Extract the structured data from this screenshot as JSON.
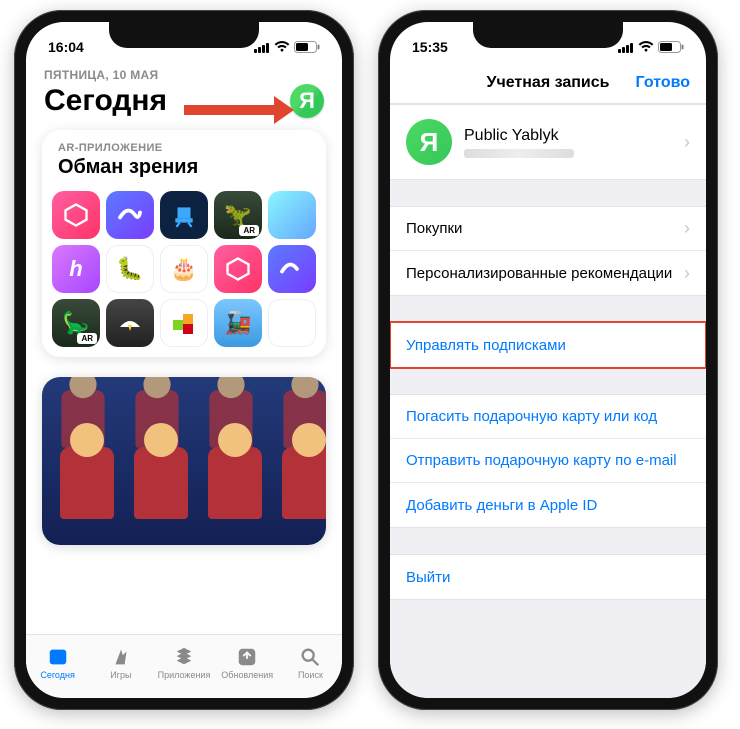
{
  "left": {
    "time": "16:04",
    "date_line": "ПЯТНИЦА, 10 МАЯ",
    "title": "Сегодня",
    "avatar_letter": "Я",
    "card": {
      "tag": "AR-ПРИЛОЖЕНИЕ",
      "title": "Обман зрения"
    },
    "tabs": {
      "today": "Сегодня",
      "games": "Игры",
      "apps": "Приложения",
      "updates": "Обновления",
      "search": "Поиск"
    }
  },
  "right": {
    "time": "15:35",
    "nav_title": "Учетная запись",
    "done": "Готово",
    "profile_name": "Public Yablyk",
    "avatar_letter": "Я",
    "rows": {
      "purchases": "Покупки",
      "personalized": "Персонализированные рекомендации",
      "subscriptions": "Управлять подписками",
      "redeem": "Погасить подарочную карту или код",
      "send_gift": "Отправить подарочную карту по e-mail",
      "add_funds": "Добавить деньги в Apple ID",
      "sign_out": "Выйти"
    }
  }
}
